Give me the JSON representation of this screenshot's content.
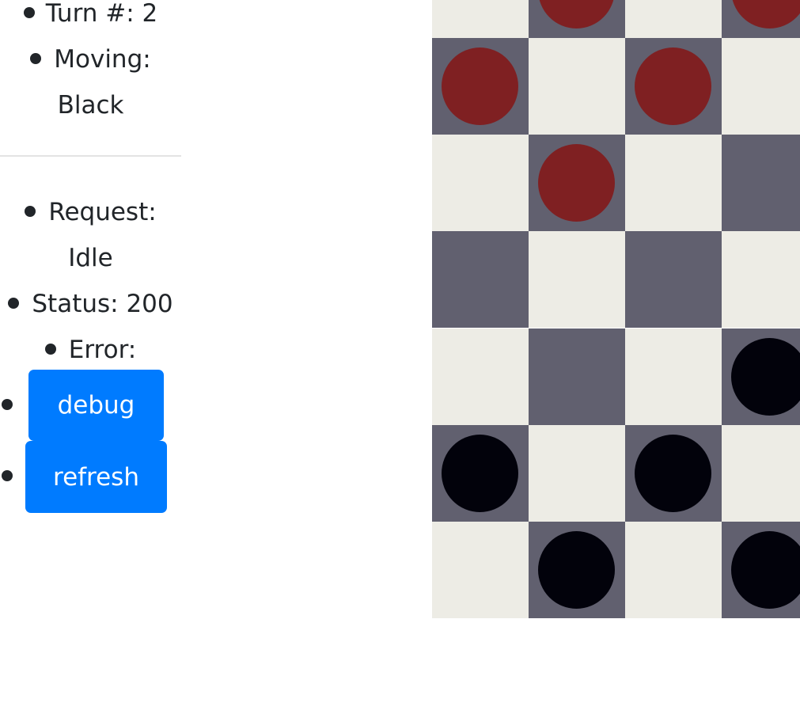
{
  "game_info": {
    "turn_label": "Turn #: 2",
    "moving_label": "Moving:",
    "moving_value": "Black"
  },
  "request_info": {
    "request_label": "Request:",
    "request_value": "Idle",
    "status_label": "Status: 200",
    "error_label": "Error:"
  },
  "buttons": {
    "debug_label": "debug",
    "refresh_label": "refresh"
  },
  "colors": {
    "button_bg": "#007bff",
    "light_square": "#edece5",
    "dark_square": "#61606f",
    "red_piece": "#7f2022",
    "black_piece": "#02020b"
  },
  "board": {
    "visible_rows": [
      [
        "empty-light",
        "red",
        "empty-light",
        "red"
      ],
      [
        "red",
        "empty-light",
        "red",
        "empty-light"
      ],
      [
        "empty-light",
        "red",
        "empty-light",
        "empty-dark"
      ],
      [
        "empty-dark",
        "empty-light",
        "empty-dark",
        "empty-light"
      ],
      [
        "empty-light",
        "empty-dark",
        "empty-light",
        "black"
      ],
      [
        "black",
        "empty-light",
        "black",
        "empty-light"
      ],
      [
        "empty-light",
        "black",
        "empty-light",
        "black"
      ]
    ]
  }
}
